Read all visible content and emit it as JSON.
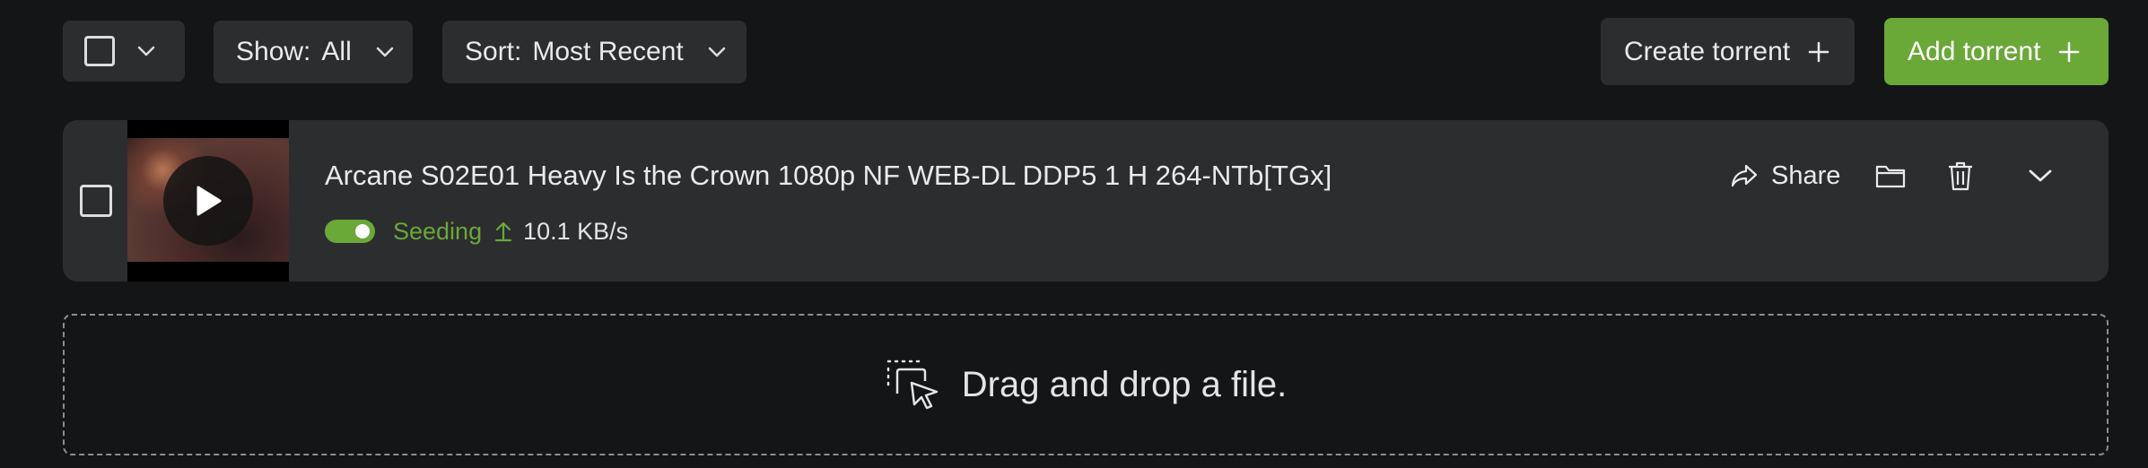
{
  "toolbar": {
    "show_label": "Show:",
    "show_value": "All",
    "sort_label": "Sort:",
    "sort_value": "Most Recent",
    "create_label": "Create torrent",
    "add_label": "Add torrent"
  },
  "torrent": {
    "title": "Arcane S02E01 Heavy Is the Crown 1080p NF WEB-DL DDP5 1 H 264-NTb[TGx]",
    "status": "Seeding",
    "upload_speed": "10.1 KB/s",
    "seeding_enabled": true
  },
  "actions": {
    "share_label": "Share"
  },
  "dropzone": {
    "text": "Drag and drop a file."
  },
  "colors": {
    "background": "#141516",
    "surface": "#2c2d2f",
    "accent_green": "#6aa838",
    "text": "#e9eaec"
  },
  "icons": [
    "checkbox-icon",
    "chevron-down-icon",
    "plus-icon",
    "play-icon",
    "upload-arrow-icon",
    "share-icon",
    "folder-icon",
    "trash-icon",
    "drag-drop-icon"
  ]
}
